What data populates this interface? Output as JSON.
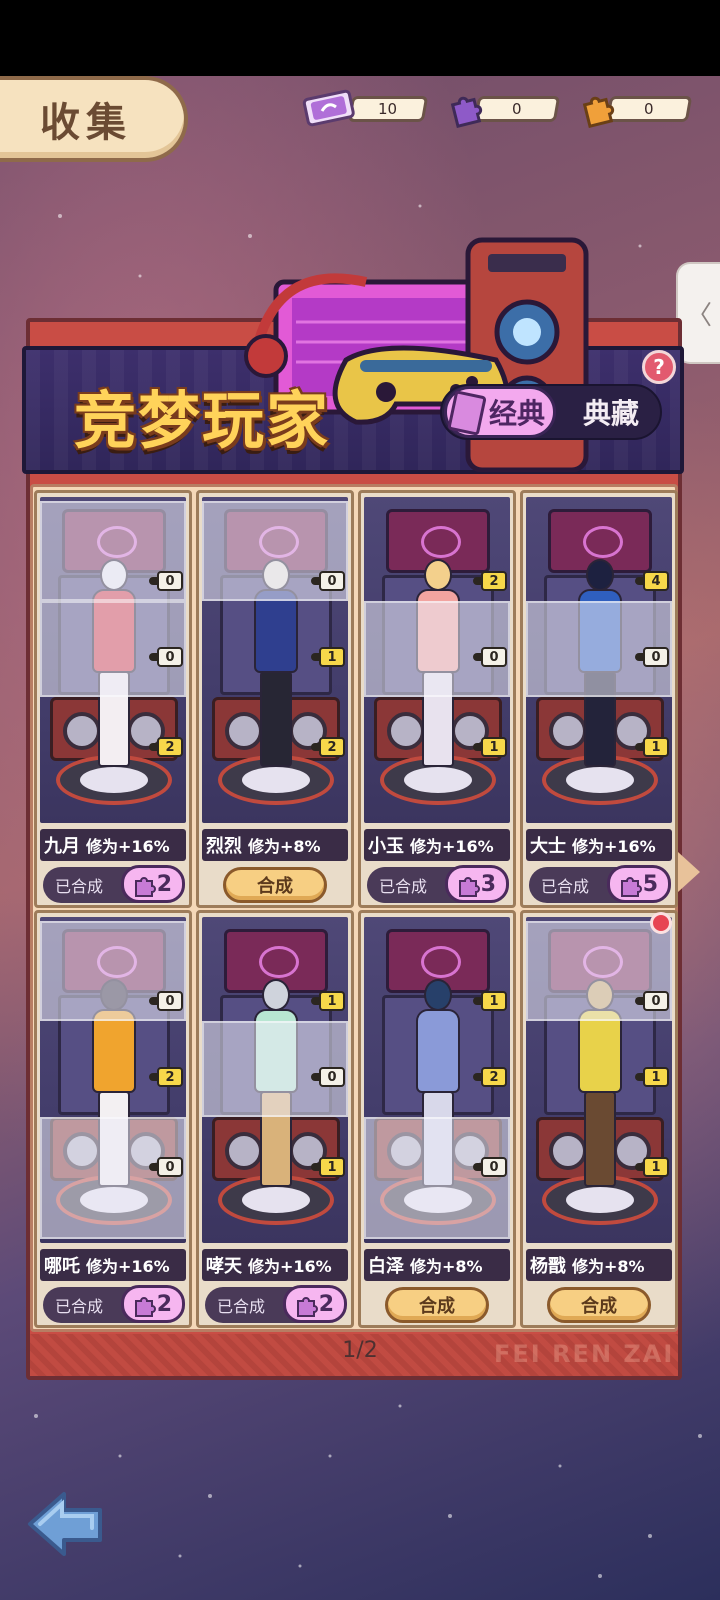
{
  "header": {
    "title": "收集",
    "currencies": [
      {
        "icon": "ticket-icon",
        "value": "10",
        "color": "#b06fd8"
      },
      {
        "icon": "purple-puzzle-piece-icon",
        "value": "0",
        "color": "#8e5ac8"
      },
      {
        "icon": "orange-puzzle-piece-icon",
        "value": "0",
        "color": "#f0a03a"
      }
    ]
  },
  "side_handle": {
    "glyph": "〈"
  },
  "banner": {
    "title": "竞梦玩家",
    "tabs": [
      {
        "label": "经典",
        "active": true
      },
      {
        "label": "典藏",
        "active": false
      }
    ],
    "help_glyph": "?"
  },
  "cards": [
    {
      "name": "九月",
      "bonus": "修为+16%",
      "status": "已合成",
      "count": "2",
      "badges": [
        "0",
        "0",
        "2"
      ],
      "palette": {
        "hair": "#ecebf2",
        "top": "#d8424e",
        "legs": "#f3eef2"
      }
    },
    {
      "name": "烈烈",
      "bonus": "修为+8%",
      "action": "合成",
      "badges": [
        "0",
        "1",
        "2"
      ],
      "palette": {
        "hair": "#e9e4dc",
        "top": "#2f3f8f",
        "legs": "#272634"
      }
    },
    {
      "name": "小玉",
      "bonus": "修为+16%",
      "status": "已合成",
      "count": "3",
      "badges": [
        "2",
        "0",
        "1"
      ],
      "palette": {
        "hair": "#f3d08c",
        "top": "#f2a4a0",
        "legs": "#e8e2ee"
      }
    },
    {
      "name": "大士",
      "bonus": "修为+16%",
      "status": "已合成",
      "count": "5",
      "badges": [
        "4",
        "0",
        "1"
      ],
      "palette": {
        "hair": "#1d2140",
        "top": "#2f5fbf",
        "legs": "#23233a"
      }
    },
    {
      "name": "哪吒",
      "bonus": "修为+16%",
      "status": "已合成",
      "count": "2",
      "badges": [
        "0",
        "2",
        "0"
      ],
      "palette": {
        "hair": "#3a3346",
        "top": "#f0a42e",
        "legs": "#f3f0f2"
      }
    },
    {
      "name": "哮天",
      "bonus": "修为+16%",
      "status": "已合成",
      "count": "2",
      "badges": [
        "1",
        "0",
        "1"
      ],
      "palette": {
        "hair": "#cfd3dc",
        "top": "#b8e6d2",
        "legs": "#d9b27a"
      }
    },
    {
      "name": "白泽",
      "bonus": "修为+8%",
      "action": "合成",
      "badges": [
        "1",
        "2",
        "0"
      ],
      "palette": {
        "hair": "#27406a",
        "top": "#8a9ad8",
        "legs": "#d8d8ea"
      }
    },
    {
      "name": "杨戬",
      "bonus": "修为+8%",
      "action": "合成",
      "badges": [
        "0",
        "1",
        "1"
      ],
      "palette": {
        "hair": "#c9a86a",
        "top": "#e8d24a",
        "legs": "#6a4a32"
      }
    }
  ],
  "pager": {
    "text": "1/2",
    "watermark": "FEI REN ZAI"
  }
}
